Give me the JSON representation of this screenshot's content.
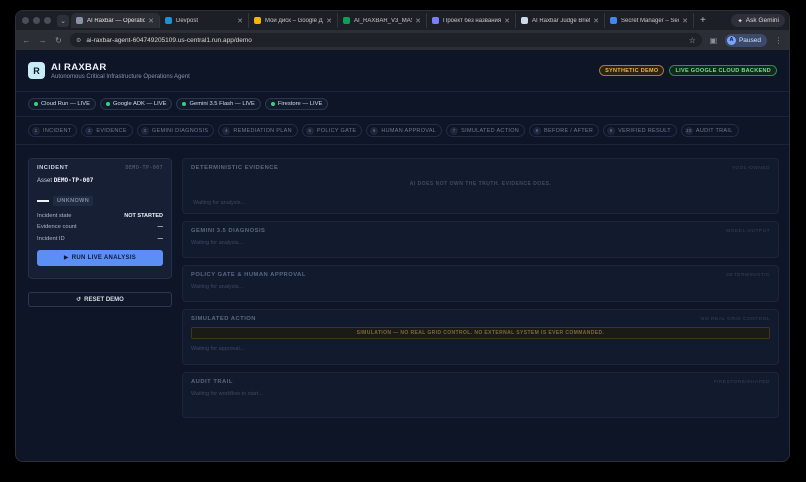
{
  "browser": {
    "tabs": [
      {
        "title": "AI Raxbar — Operation",
        "color": "#8a93a5",
        "active": true
      },
      {
        "title": "Devpost",
        "color": "#1f8fd6",
        "active": false
      },
      {
        "title": "Мой диск – Google Ди",
        "color": "#f4b400",
        "active": false
      },
      {
        "title": "AI_RAXBAR_V3_MAS",
        "color": "#0f9d58",
        "active": false
      },
      {
        "title": "Проект без названия",
        "color": "#7c7cff",
        "active": false
      },
      {
        "title": "AI Raxbar Judge Brief",
        "color": "#cfd8e8",
        "active": false
      },
      {
        "title": "Secret Manager – Secr",
        "color": "#4285f4",
        "active": false
      }
    ],
    "ask_gemini": "Ask Gemini",
    "url": "ai-raxbar-agent-604749205109.us-central1.run.app/demo",
    "profile_label": "Paused"
  },
  "header": {
    "logo": "R",
    "title": "AI RAXBAR",
    "subtitle": "Autonomous Critical Infrastructure Operations Agent",
    "badge_synthetic": "SYNTHETIC DEMO",
    "badge_live": "LIVE GOOGLE CLOUD BACKEND"
  },
  "services": [
    "Cloud Run — LIVE",
    "Google ADK — LIVE",
    "Gemini 3.5 Flash — LIVE",
    "Firestore — LIVE"
  ],
  "steps": [
    {
      "n": "1",
      "label": "INCIDENT"
    },
    {
      "n": "2",
      "label": "EVIDENCE"
    },
    {
      "n": "3",
      "label": "GEMINI DIAGNOSIS"
    },
    {
      "n": "4",
      "label": "REMEDIATION PLAN"
    },
    {
      "n": "5",
      "label": "POLICY GATE"
    },
    {
      "n": "6",
      "label": "HUMAN APPROVAL"
    },
    {
      "n": "7",
      "label": "SIMULATED ACTION"
    },
    {
      "n": "8",
      "label": "BEFORE / AFTER"
    },
    {
      "n": "9",
      "label": "VERIFIED RESULT"
    },
    {
      "n": "10",
      "label": "AUDIT TRAIL"
    }
  ],
  "incident": {
    "label": "INCIDENT",
    "id": "DEMO-TP-007",
    "asset_label": "Asset",
    "asset_value": "DEMO-TP-007",
    "status": "UNKNOWN",
    "rows": [
      {
        "k": "Incident state",
        "v": "NOT STARTED"
      },
      {
        "k": "Evidence count",
        "v": "—"
      },
      {
        "k": "Incident ID",
        "v": "—"
      }
    ],
    "run_label": "RUN LIVE ANALYSIS",
    "reset_label": "RESET DEMO"
  },
  "panels": {
    "evidence": {
      "title": "DETERMINISTIC EVIDENCE",
      "right": "TOOL-OWNED",
      "note": "AI DOES NOT OWN THE TRUTH. EVIDENCE DOES.",
      "wait": "Waiting for analysis..."
    },
    "diagnosis": {
      "title": "GEMINI 3.5 DIAGNOSIS",
      "right": "MODEL OUTPUT",
      "wait": "Waiting for analysis..."
    },
    "policy": {
      "title": "POLICY GATE & HUMAN APPROVAL",
      "right": "DETERMINISTIC",
      "wait": "Waiting for analysis..."
    },
    "simulated": {
      "title": "SIMULATED ACTION",
      "right": "NO REAL GRID CONTROL",
      "banner": "SIMULATION — NO REAL GRID CONTROL. NO EXTERNAL SYSTEM IS EVER COMMANDED.",
      "wait": "Waiting for approval..."
    },
    "audit": {
      "title": "AUDIT TRAIL",
      "right": "FIRESTORE/SHAPED",
      "wait": "Waiting for workflow to start..."
    }
  }
}
